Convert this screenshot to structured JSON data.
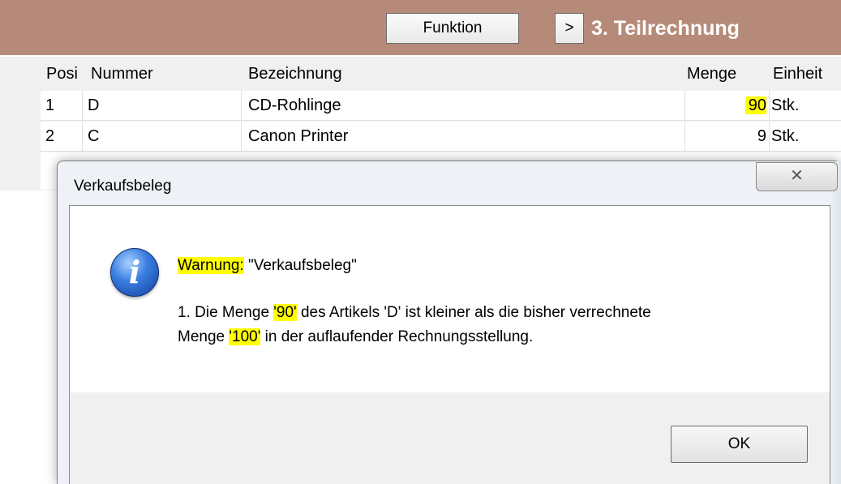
{
  "toolbar": {
    "function_label": "Funktion",
    "next_label": ">",
    "step_title": "3. Teilrechnung"
  },
  "grid": {
    "columns": [
      "Posi",
      "Nummer",
      "Bezeichnung",
      "Menge",
      "Einheit"
    ],
    "rows": [
      {
        "pos": "1",
        "nummer": "D",
        "bezeichnung": "CD-Rohlinge",
        "menge": "90",
        "einheit": "Stk."
      },
      {
        "pos": "2",
        "nummer": "C",
        "bezeichnung": "Canon Printer",
        "menge": "9",
        "einheit": "Stk."
      }
    ]
  },
  "dialog": {
    "title": "Verkaufsbeleg",
    "close_glyph": "✕",
    "icon": "info-icon",
    "warning_label": "Warnung:",
    "warning_text": " \"Verkaufsbeleg\"",
    "line1_a": "1. Die Menge ",
    "line1_qty": "'90'",
    "line1_b": " des Artikels 'D' ist kleiner als die bisher verrechnete",
    "line2_a": "Menge ",
    "line2_qty": "'100'",
    "line2_b": " in der auflaufender Rechnungsstellung.",
    "ok_label": "OK"
  },
  "colors": {
    "toolbar_bg": "#b68a78",
    "highlight": "#ffff00",
    "info_icon": "#3a7de0"
  }
}
